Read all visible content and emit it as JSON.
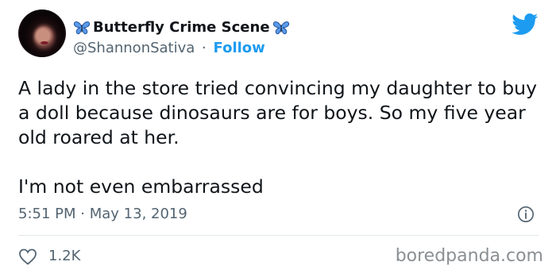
{
  "author": {
    "display_name": "Butterfly Crime Scene",
    "handle": "@ShannonSativa",
    "separator": "·",
    "follow_label": "Follow"
  },
  "tweet": {
    "paragraph_1": "A lady in the store tried convincing my daughter to buy a doll because dinosaurs are for boys. So my five year old roared at her.",
    "paragraph_2": "I'm not even embarrassed",
    "time": "5:51 PM",
    "date_separator": "·",
    "date": "May 13, 2019",
    "like_count": "1.2K"
  },
  "watermark": "boredpanda.com",
  "colors": {
    "accent": "#1d9bf0",
    "text": "#0f1419",
    "secondary": "#536471",
    "butterfly": "#2f6fcf"
  },
  "icons": {
    "logo": "twitter-bird-icon",
    "info": "info-icon",
    "like": "heart-icon",
    "emoji": "butterfly-icon"
  }
}
